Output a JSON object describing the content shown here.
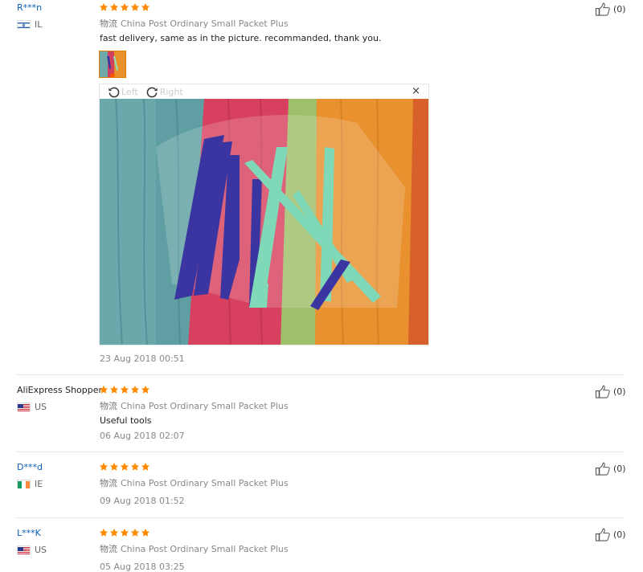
{
  "colors": {
    "link": "#0a5fb4",
    "star": "#ff8a00",
    "accent": "#e57b00"
  },
  "reviews": [
    {
      "name": "R***n",
      "country": "IL",
      "flag": "israel-flag-icon",
      "stars": 5,
      "shipping_cn": "物流",
      "shipping": "China Post Ordinary Small Packet Plus",
      "text": "fast delivery, same as in the picture. recommanded, thank you.",
      "date": "23 Aug 2018 00:51",
      "helpful": "(0)",
      "viewer": {
        "rotate_left": "Left",
        "rotate_right": "Right",
        "close": "×"
      }
    },
    {
      "name": "AliExpress Shopper",
      "country": "US",
      "flag": "us-flag-icon",
      "stars": 5,
      "shipping_cn": "物流",
      "shipping": "China Post Ordinary Small Packet Plus",
      "text": "Useful tools",
      "date": "06 Aug 2018 02:07",
      "helpful": "(0)"
    },
    {
      "name": "D***d",
      "country": "IE",
      "flag": "ireland-flag-icon",
      "stars": 5,
      "shipping_cn": "物流",
      "shipping": "China Post Ordinary Small Packet Plus",
      "date": "09 Aug 2018 01:52",
      "helpful": "(0)"
    },
    {
      "name": "L***K",
      "country": "US",
      "flag": "us-flag-icon",
      "stars": 5,
      "shipping_cn": "物流",
      "shipping": "China Post Ordinary Small Packet Plus",
      "date": "05 Aug 2018 03:25",
      "helpful": "(0)"
    }
  ]
}
